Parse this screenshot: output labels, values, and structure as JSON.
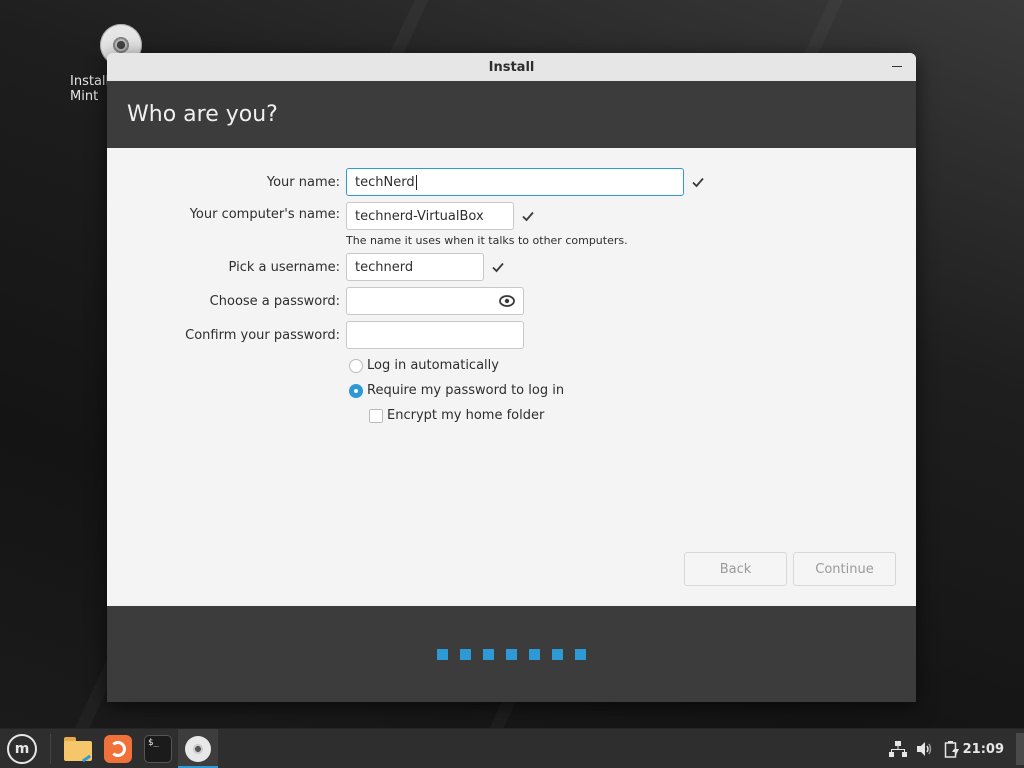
{
  "desktop": {
    "icons": [
      {
        "label": "Install Linux Mint",
        "icon": "disc-icon"
      }
    ]
  },
  "window": {
    "title": "Install",
    "minimize_icon": "minimize-icon",
    "header": "Who are you?",
    "form": {
      "your_name": {
        "label": "Your name:",
        "value": "techNerd",
        "valid": true
      },
      "computer_name": {
        "label": "Your computer's name:",
        "value": "technerd-VirtualBox",
        "valid": true,
        "hint": "The name it uses when it talks to other computers."
      },
      "username": {
        "label": "Pick a username:",
        "value": "technerd",
        "valid": true
      },
      "password": {
        "label": "Choose a password:",
        "value": "",
        "reveal_icon": "eye-icon"
      },
      "confirm_password": {
        "label": "Confirm your password:",
        "value": ""
      }
    },
    "login_options": {
      "auto_login": {
        "label": "Log in automatically",
        "selected": false
      },
      "require_password": {
        "label": "Require my password to log in",
        "selected": true
      },
      "encrypt_home": {
        "label": "Encrypt my home folder",
        "checked": false
      }
    },
    "buttons": {
      "back": "Back",
      "continue": "Continue"
    },
    "progress": {
      "steps_total": 7,
      "steps_completed": 7
    }
  },
  "taskbar": {
    "menu_icon": "linux-mint-logo-icon",
    "launchers": [
      {
        "name": "Files",
        "icon": "folder-icon"
      },
      {
        "name": "Firefox",
        "icon": "firefox-icon"
      },
      {
        "name": "Terminal",
        "icon": "terminal-icon",
        "glyph": "$_"
      },
      {
        "name": "Install",
        "icon": "disc-icon",
        "active": true
      }
    ],
    "tray": {
      "network_icon": "network-icon",
      "volume_icon": "volume-icon",
      "battery_icon": "battery-icon"
    },
    "clock": "21:09"
  }
}
